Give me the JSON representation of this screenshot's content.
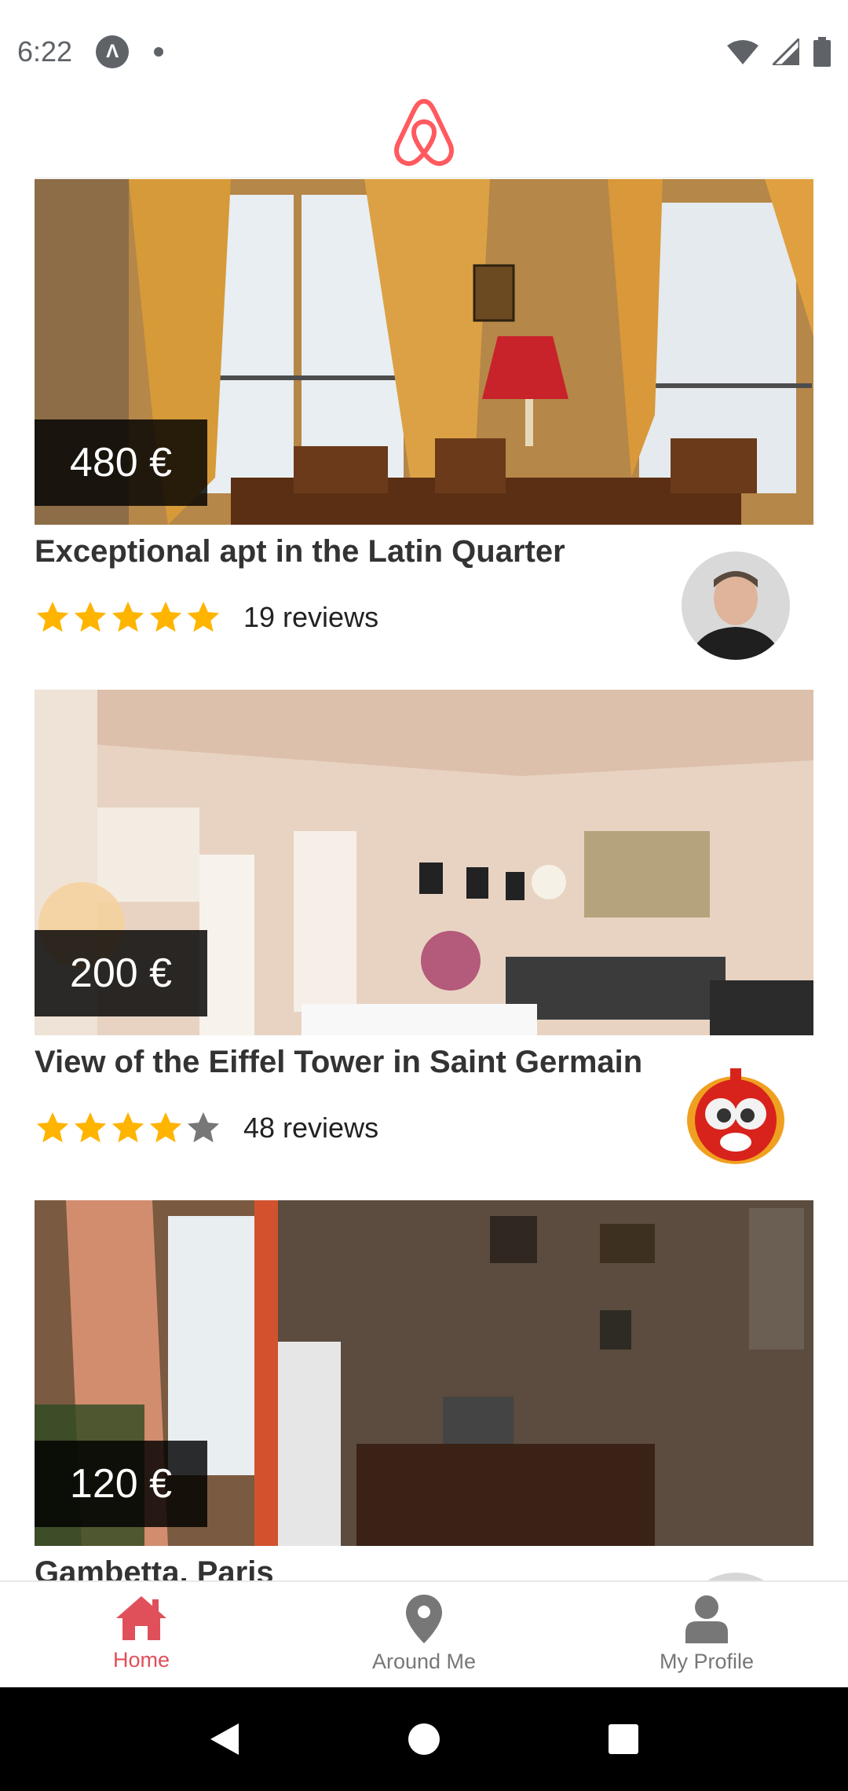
{
  "status_bar": {
    "time": "6:22"
  },
  "header": {
    "logo_icon": "airbnb-logo-icon",
    "brand_color": "#ff5a5f"
  },
  "listings": [
    {
      "price": "480 €",
      "title": "Exceptional apt in the Latin Quarter",
      "rating": 5,
      "reviews": "19 reviews"
    },
    {
      "price": "200 €",
      "title": "View of the Eiffel Tower in Saint Germain",
      "rating": 4,
      "reviews": "48 reviews"
    },
    {
      "price": "120 €",
      "title": "Gambetta, Paris"
    }
  ],
  "bottom_nav": {
    "items": [
      {
        "label": "Home",
        "icon": "home-icon",
        "active": true
      },
      {
        "label": "Around Me",
        "icon": "map-pin-icon",
        "active": false
      },
      {
        "label": "My Profile",
        "icon": "user-icon",
        "active": false
      }
    ]
  },
  "colors": {
    "star": "#ffb400",
    "star_empty": "#777777",
    "accent": "#e0505a"
  }
}
